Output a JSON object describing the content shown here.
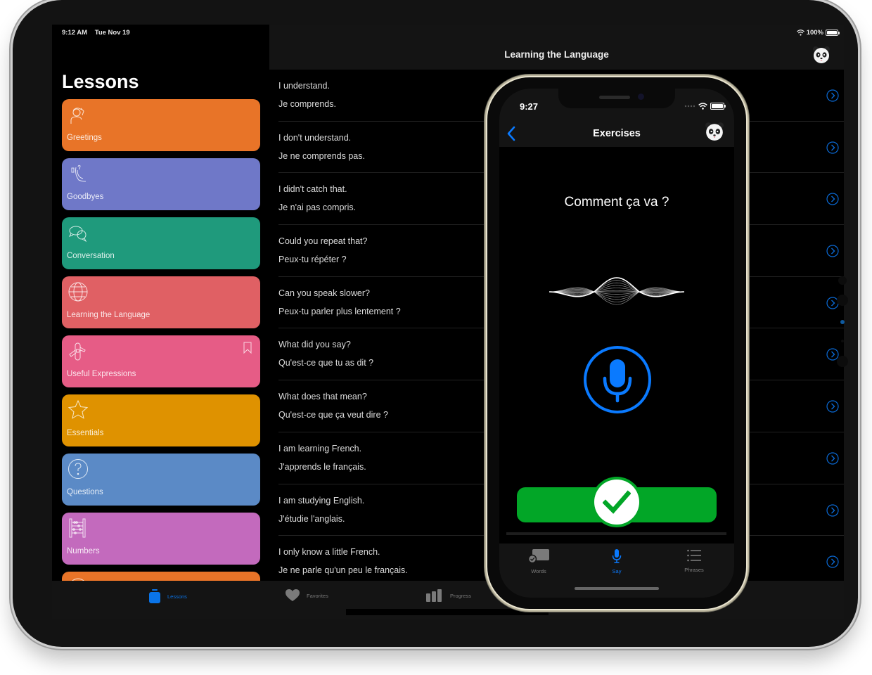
{
  "ipad": {
    "status_bar": {
      "time": "9:12 AM",
      "date": "Tue Nov 19",
      "battery": "100%",
      "battery_level": 1.0
    },
    "sidebar": {
      "title": "Lessons",
      "cards": [
        {
          "label": "Greetings",
          "icon": "greeting-person-icon",
          "color": "#e87428"
        },
        {
          "label": "Goodbyes",
          "icon": "waving-hand-icon",
          "color": "#6f78c8"
        },
        {
          "label": "Conversation",
          "icon": "speech-bubbles-icon",
          "color": "#1f9a7c"
        },
        {
          "label": "Learning the Language",
          "icon": "globe-icon",
          "color": "#e06064"
        },
        {
          "label": "Useful Expressions",
          "icon": "swiss-knife-icon",
          "color": "#e65c86",
          "bookmarked": true
        },
        {
          "label": "Essentials",
          "icon": "star-icon",
          "color": "#df9200"
        },
        {
          "label": "Questions",
          "icon": "question-circle-icon",
          "color": "#5b8ac6"
        },
        {
          "label": "Numbers",
          "icon": "abacus-icon",
          "color": "#c36abd"
        },
        {
          "label": "",
          "icon": "clock-icon",
          "color": "#e87428"
        }
      ]
    },
    "detail": {
      "title": "Learning the Language",
      "phrases": [
        {
          "en": "I understand.",
          "fr": "Je comprends."
        },
        {
          "en": "I don't understand.",
          "fr": "Je ne comprends pas."
        },
        {
          "en": "I didn't catch that.",
          "fr": "Je n'ai pas compris."
        },
        {
          "en": "Could you repeat that?",
          "fr": "Peux-tu répéter ?"
        },
        {
          "en": "Can you speak slower?",
          "fr": "Peux-tu parler plus lentement ?"
        },
        {
          "en": "What did you say?",
          "fr": "Qu'est-ce que tu as dit ?"
        },
        {
          "en": "What does that mean?",
          "fr": "Qu'est-ce que ça veut dire ?"
        },
        {
          "en": "I am learning French.",
          "fr": "J'apprends le français."
        },
        {
          "en": "I am studying English.",
          "fr": "J'étudie l'anglais."
        },
        {
          "en": "I only know a little French.",
          "fr": "Je ne parle qu'un peu le français."
        }
      ]
    },
    "tabbar": {
      "tabs": [
        {
          "label": "Lessons",
          "icon": "book-jar-icon",
          "active": true
        },
        {
          "label": "Favorites",
          "icon": "heart-icon",
          "active": false
        },
        {
          "label": "Progress",
          "icon": "bar-chart-icon",
          "active": false
        }
      ]
    }
  },
  "iphone": {
    "status_bar": {
      "time": "9:27"
    },
    "nav": {
      "title": "Exercises"
    },
    "exercise": {
      "prompt": "Comment ça va ?",
      "result": "correct"
    },
    "tabbar": {
      "tabs": [
        {
          "label": "Words",
          "icon": "flashcard-check-icon",
          "active": false
        },
        {
          "label": "Say",
          "icon": "microphone-icon",
          "active": true
        },
        {
          "label": "Phrases",
          "icon": "list-icon",
          "active": false
        }
      ]
    }
  },
  "colors": {
    "accent": "#0a7aff",
    "success": "#02a627",
    "background": "#000000",
    "bar": "#141414"
  }
}
